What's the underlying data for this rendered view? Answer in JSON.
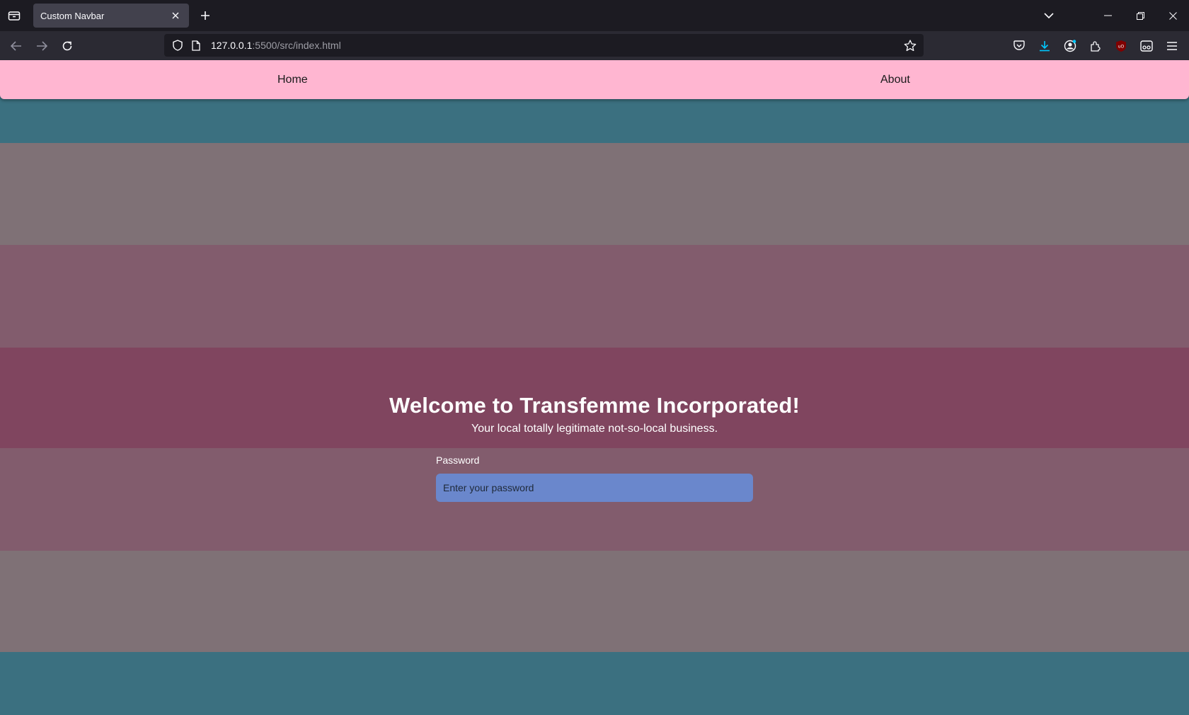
{
  "browser": {
    "tab": {
      "title": "Custom Navbar"
    },
    "url": {
      "host": "127.0.0.1",
      "rest": ":5500/src/index.html"
    }
  },
  "site": {
    "nav": {
      "home": "Home",
      "about": "About"
    },
    "hero": {
      "title": "Welcome to Transfemme Incorporated!",
      "subtitle": "Your local totally legitimate not-so-local business."
    },
    "password": {
      "label": "Password",
      "placeholder": "Enter your password",
      "value": ""
    }
  },
  "colors": {
    "chrome_dark": "#1c1b22",
    "chrome_toolbar": "#2b2a33",
    "nav_pink": "#ffb6d1",
    "stripe_teal": "#3b7080",
    "stripe_grey": "#7f7176",
    "stripe_mauve": "#825c6d",
    "stripe_plum": "#80455f",
    "input_blue": "#6a87cc"
  }
}
